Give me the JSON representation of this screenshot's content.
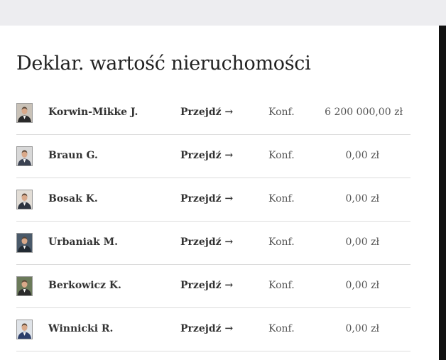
{
  "title": "Deklar. wartość nieruchomości",
  "rows": [
    {
      "name": "Korwin-Mikke J.",
      "link": "Przejdź →",
      "party": "Konf.",
      "value": "6 200 000,00 zł",
      "avatar_bg": "#c9c2b8",
      "suit": "#2a2a2a"
    },
    {
      "name": "Braun G.",
      "link": "Przejdź →",
      "party": "Konf.",
      "value": "0,00 zł",
      "avatar_bg": "#d8d8d8",
      "suit": "#3b4252"
    },
    {
      "name": "Bosak K.",
      "link": "Przejdź →",
      "party": "Konf.",
      "value": "0,00 zł",
      "avatar_bg": "#e2ddd6",
      "suit": "#2d3440"
    },
    {
      "name": "Urbaniak M.",
      "link": "Przejdź →",
      "party": "Konf.",
      "value": "0,00 zł",
      "avatar_bg": "#4a5a6a",
      "suit": "#222a33"
    },
    {
      "name": "Berkowicz K.",
      "link": "Przejdź →",
      "party": "Konf.",
      "value": "0,00 zł",
      "avatar_bg": "#6b7a5a",
      "suit": "#2b2b2b"
    },
    {
      "name": "Winnicki R.",
      "link": "Przejdź →",
      "party": "Konf.",
      "value": "0,00 zł",
      "avatar_bg": "#dfe3e8",
      "suit": "#2c3e6a"
    }
  ]
}
